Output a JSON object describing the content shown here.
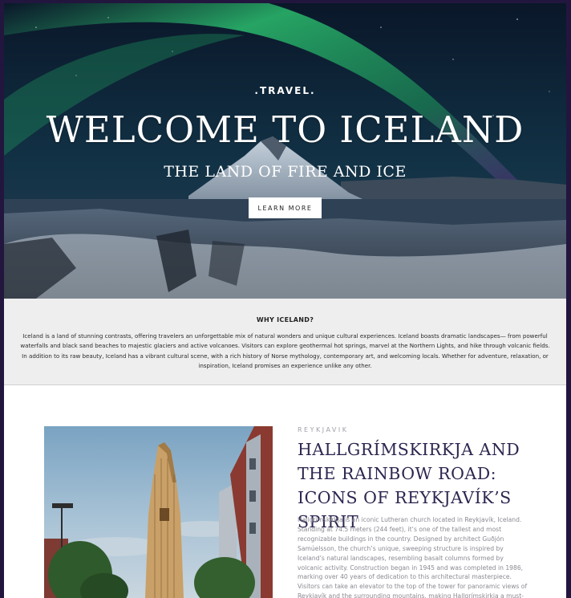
{
  "hero": {
    "kicker": ".TRAVEL.",
    "title": "WELCOME TO ICELAND",
    "subtitle": "THE LAND OF FIRE AND ICE",
    "button_label": "LEARN MORE"
  },
  "why": {
    "title": "WHY ICELAND?",
    "text": "Iceland is a land of stunning contrasts, offering travelers an unforgettable mix of natural wonders and unique cultural experiences. Iceland boasts dramatic landscapes— from powerful waterfalls and black sand beaches to majestic glaciers and active volcanoes. Visitors can explore geothermal hot springs, marvel at the Northern Lights, and hike through volcanic fields. In addition to its raw beauty, Iceland has a vibrant cultural scene, with a rich history of Norse mythology, contemporary art, and welcoming locals. Whether for adventure, relaxation, or inspiration, Iceland promises an experience unlike any other."
  },
  "feature": {
    "kicker": "REYKJAVIK",
    "title": "HALLGRÍMSKIRKJA AND THE RAINBOW ROAD: ICONS OF REYKJAVÍK’S SPIRIT",
    "body": "Hallgrímskirkja is an iconic Lutheran church located in Reykjavík, Iceland. Standing at 74.5 meters (244 feet), it’s one of the tallest and most recognizable buildings in the country. Designed by architect Guðjón Samúelsson, the church’s unique, sweeping structure is inspired by Iceland’s natural landscapes, resembling basalt columns formed by volcanic activity. Construction began in 1945 and was completed in 1986, marking over 40 years of dedication to this architectural masterpiece. Visitors can take an elevator to the top of the tower for panoramic views of Reykjavík and the surrounding mountains, making Hallgrímskirkja a must-"
  },
  "colors": {
    "page_border": "#22163f",
    "title_text": "#2d2650",
    "section_bg": "#eeeeee"
  }
}
